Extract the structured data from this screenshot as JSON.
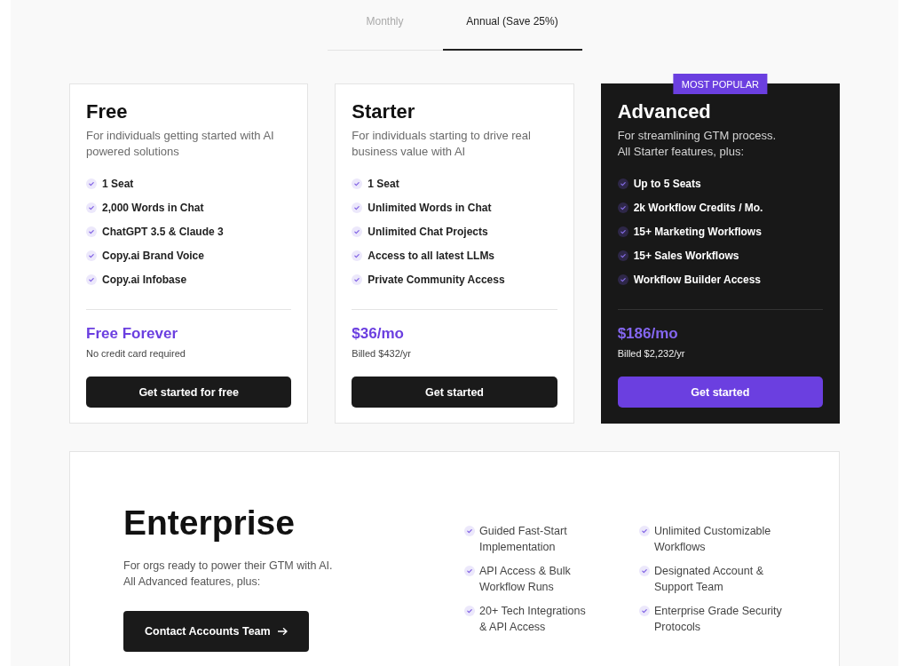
{
  "billing_tabs": [
    {
      "label": "Monthly",
      "selected": false
    },
    {
      "label": "Annual (Save 25%)",
      "selected": true
    }
  ],
  "plans": [
    {
      "name": "Free",
      "featured": false,
      "description": "For individuals getting started with AI powered solutions",
      "features": [
        "1 Seat",
        "2,000 Words in Chat",
        "ChatGPT 3.5 & Claude 3",
        "Copy.ai Brand Voice",
        "Copy.ai Infobase"
      ],
      "price": "Free Forever",
      "price_note": "No credit card required",
      "button": "Get started for free"
    },
    {
      "name": "Starter",
      "featured": false,
      "description": "For individuals starting to drive real business value with AI",
      "features": [
        "1 Seat",
        "Unlimited Words in Chat",
        "Unlimited Chat Projects",
        "Access to all latest LLMs",
        "Private Community Access"
      ],
      "price": "$36/mo",
      "price_note": "Billed $432/yr",
      "button": "Get started"
    },
    {
      "name": "Advanced",
      "featured": true,
      "badge": "MOST POPULAR",
      "description": "For streamlining GTM process.\nAll Starter features, plus:",
      "features": [
        "Up to 5 Seats",
        "2k Workflow Credits / Mo.",
        "15+ Marketing Workflows",
        "15+ Sales Workflows",
        "Workflow Builder Access"
      ],
      "price": "$186/mo",
      "price_note": "Billed $2,232/yr",
      "button": "Get started"
    }
  ],
  "enterprise": {
    "title": "Enterprise",
    "description": "For orgs ready to power their GTM with AI.\nAll Advanced features, plus:",
    "button": "Contact Accounts Team",
    "features": [
      "Guided Fast-Start\nImplementation",
      "Unlimited Customizable\nWorkflows",
      "API Access & Bulk\nWorkflow Runs",
      "Designated Account &\nSupport Team",
      "20+ Tech Integrations\n& API Access",
      "Enterprise Grade Security\nProtocols"
    ]
  }
}
